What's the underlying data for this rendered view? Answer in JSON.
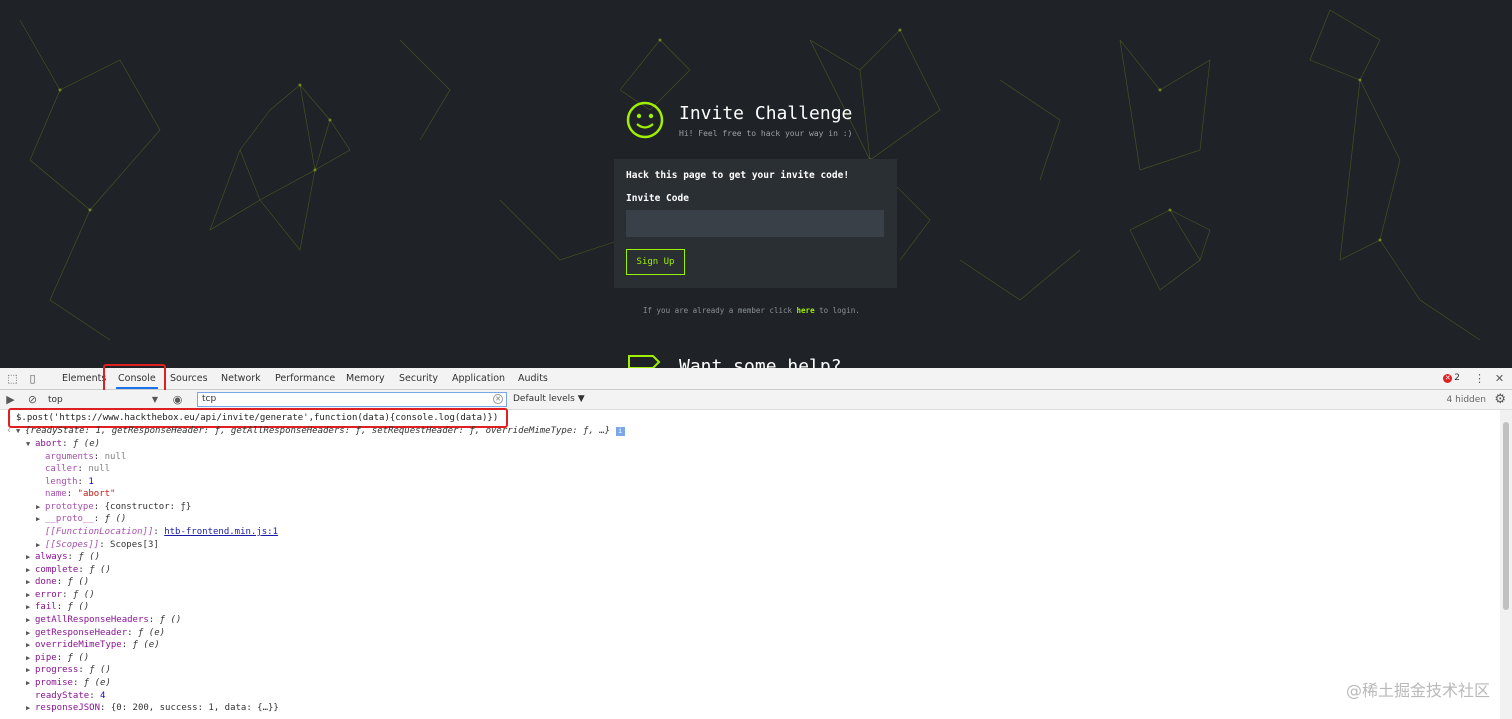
{
  "page": {
    "title": "Invite Challenge",
    "subtitle": "Hi! Feel free to hack your way in :)",
    "card_heading": "Hack this page to get your invite code!",
    "invite_label": "Invite Code",
    "invite_value": "",
    "signup_label": "Sign Up",
    "member_text_before": "If you are already a member click",
    "member_link": "here",
    "member_text_after": "to login.",
    "help_title": "Want some help?",
    "accent_color": "#9fef00"
  },
  "devtools": {
    "tabs": [
      "Elements",
      "Console",
      "Sources",
      "Network",
      "Performance",
      "Memory",
      "Security",
      "Application",
      "Audits"
    ],
    "active_tab": "Console",
    "error_count": "2",
    "context": "top",
    "filter": "tcp",
    "levels": "Default levels ▼",
    "hidden": "4 hidden",
    "command": "$.post('https://www.hackthebox.eu/api/invite/generate',function(data){console.log(data)})",
    "result_summary": "{readyState: 1, getResponseHeader: ƒ, getAllResponseHeaders: ƒ, setRequestHeader: ƒ, overrideMimeType: ƒ, …}",
    "abort": {
      "key": "abort",
      "sig": "ƒ (e)",
      "arguments": "null",
      "caller": "null",
      "length": "1",
      "name": "\"abort\"",
      "prototype": "{constructor: ƒ}",
      "proto": "ƒ ()",
      "function_location": "htb-frontend.min.js:1",
      "scopes": "Scopes[3]"
    },
    "methods": [
      {
        "key": "always",
        "sig": "ƒ ()"
      },
      {
        "key": "complete",
        "sig": "ƒ ()"
      },
      {
        "key": "done",
        "sig": "ƒ ()"
      },
      {
        "key": "error",
        "sig": "ƒ ()"
      },
      {
        "key": "fail",
        "sig": "ƒ ()"
      },
      {
        "key": "getAllResponseHeaders",
        "sig": "ƒ ()"
      },
      {
        "key": "getResponseHeader",
        "sig": "ƒ (e)"
      },
      {
        "key": "overrideMimeType",
        "sig": "ƒ (e)"
      },
      {
        "key": "pipe",
        "sig": "ƒ ()"
      },
      {
        "key": "progress",
        "sig": "ƒ ()"
      },
      {
        "key": "promise",
        "sig": "ƒ (e)"
      }
    ],
    "ready_state": "4",
    "response_json": "{0: 200, success: 1, data: {…}}"
  },
  "watermark": "@稀土掘金技术社区"
}
